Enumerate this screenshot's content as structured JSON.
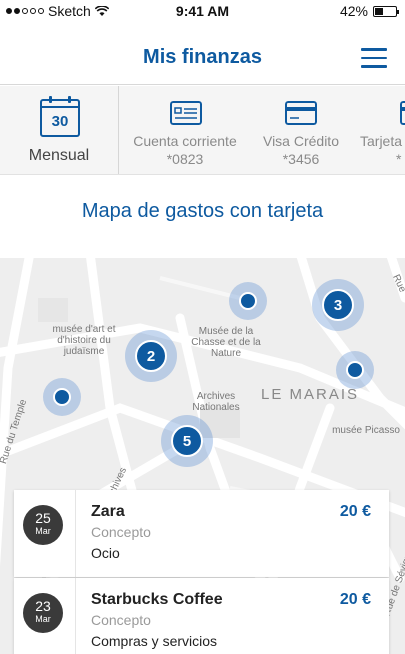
{
  "status_bar": {
    "carrier": "Sketch",
    "time": "9:41 AM",
    "battery": "42%",
    "battery_level": 0.42
  },
  "header": {
    "title": "Mis finanzas"
  },
  "accounts": {
    "monthly": {
      "day": "30",
      "label": "Mensual"
    },
    "items": [
      {
        "name": "Cuenta corriente",
        "number": "*0823"
      },
      {
        "name": "Visa Crédito",
        "number": "*3456"
      },
      {
        "name": "Tarjeta",
        "number": "*"
      }
    ]
  },
  "section_title": "Mapa de gastos con tarjeta",
  "map": {
    "labels": {
      "musee_art_histoire": "musée d'art et d'histoire du judaïsme",
      "musee_chasse": "Musée de la Chasse et de la Nature",
      "archives": "Archives Nationales",
      "le_marais": "LE MARAIS",
      "musee_picasso": "musée Picasso",
      "rue_du_temple": "Rue du Temple",
      "archives_street": "Archives",
      "rue_top": "Rue",
      "rue_sevigne": "Rue de Sévigné"
    },
    "clusters": [
      {
        "id": "cluster-2",
        "count": "2"
      },
      {
        "id": "cluster-3",
        "count": "3"
      },
      {
        "id": "cluster-5",
        "count": "5"
      }
    ]
  },
  "transactions": [
    {
      "day": "25",
      "month": "Mar",
      "merchant": "Zara",
      "concept_label": "Concepto",
      "concept": "Ocio",
      "amount": "20 €"
    },
    {
      "day": "23",
      "month": "Mar",
      "merchant": "Starbucks Coffee",
      "concept_label": "Concepto",
      "concept": "Compras y servicios",
      "amount": "20 €"
    }
  ],
  "colors": {
    "brand": "#0e5aa0",
    "map_bg": "#eeeeee",
    "date_badge": "#3a3a3a"
  }
}
